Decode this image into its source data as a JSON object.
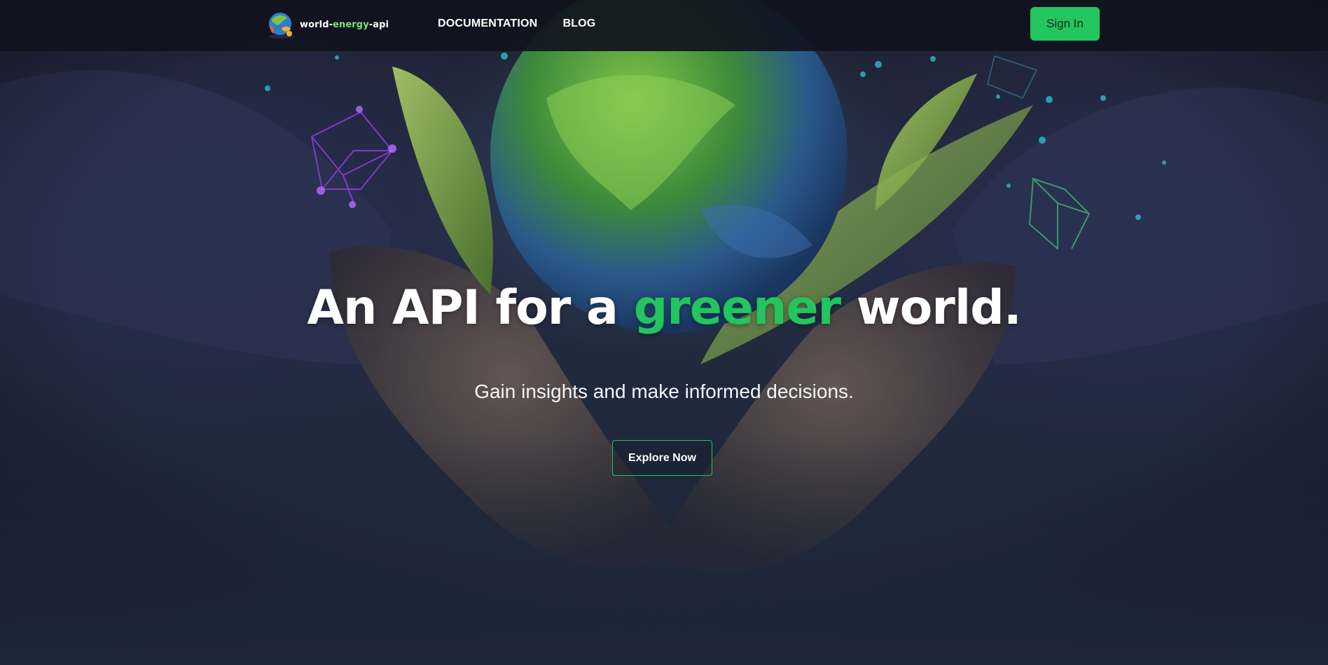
{
  "navbar": {
    "logo": {
      "part1": "world-",
      "part2": "energy",
      "part3": "-api"
    },
    "links": [
      {
        "label": "DOCUMENTATION"
      },
      {
        "label": "BLOG"
      }
    ],
    "signin_label": "Sign In"
  },
  "hero": {
    "headline_pre": "An API for a ",
    "headline_accent": "greener",
    "headline_post": " world.",
    "subheadline": "Gain insights and make informed decisions.",
    "cta_label": "Explore Now"
  },
  "colors": {
    "accent": "#22c55e",
    "navbar_bg": "#10141e",
    "page_bg": "#1e2738"
  },
  "icons": {
    "logo_mark": "earth-globe-icon"
  }
}
